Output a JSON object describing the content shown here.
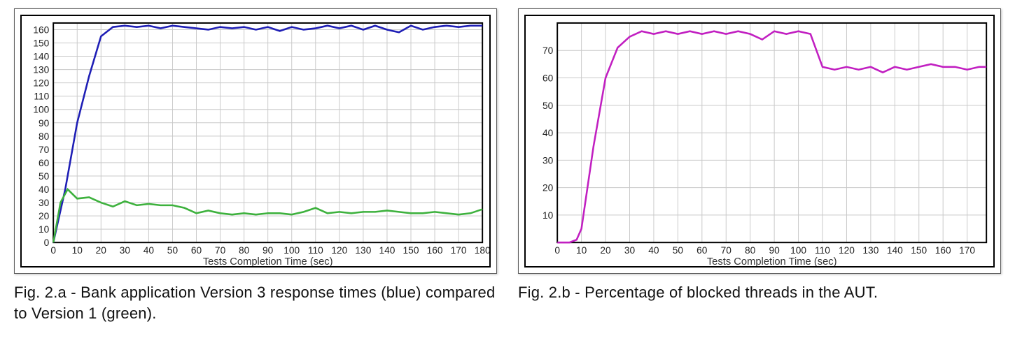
{
  "captions": {
    "a": "Fig. 2.a - Bank application Version 3 response times (blue) compared to Version 1 (green).",
    "b": "Fig. 2.b - Percentage of blocked threads in the AUT."
  },
  "xlabels": {
    "a": "Tests Completion Time (sec)",
    "b": "Tests Completion Time (sec)"
  },
  "chart_data": [
    {
      "id": "a",
      "type": "line",
      "title": "",
      "xlabel": "Tests Completion Time (sec)",
      "ylabel": "",
      "xlim": [
        0,
        180
      ],
      "ylim": [
        0,
        165
      ],
      "xticks": [
        0,
        10,
        20,
        30,
        40,
        50,
        60,
        70,
        80,
        90,
        100,
        110,
        120,
        130,
        140,
        150,
        160,
        170,
        180
      ],
      "yticks": [
        0,
        10,
        20,
        30,
        40,
        50,
        60,
        70,
        80,
        90,
        100,
        110,
        120,
        130,
        140,
        150,
        160
      ],
      "series": [
        {
          "name": "Version 3 (blue)",
          "color": "#1e1eb5",
          "cls": "blue",
          "x": [
            0,
            5,
            10,
            15,
            20,
            25,
            30,
            35,
            40,
            45,
            50,
            55,
            60,
            65,
            70,
            75,
            80,
            85,
            90,
            95,
            100,
            105,
            110,
            115,
            120,
            125,
            130,
            135,
            140,
            145,
            150,
            155,
            160,
            165,
            170,
            175,
            180
          ],
          "y": [
            0,
            40,
            90,
            125,
            155,
            162,
            163,
            162,
            163,
            161,
            163,
            162,
            161,
            160,
            162,
            161,
            162,
            160,
            162,
            159,
            162,
            160,
            161,
            163,
            161,
            163,
            160,
            163,
            160,
            158,
            163,
            160,
            162,
            163,
            162,
            163,
            163
          ]
        },
        {
          "name": "Version 1 (green)",
          "color": "#3db13d",
          "cls": "green",
          "x": [
            0,
            3,
            6,
            10,
            15,
            20,
            25,
            30,
            35,
            40,
            45,
            50,
            55,
            60,
            65,
            70,
            75,
            80,
            85,
            90,
            95,
            100,
            105,
            110,
            115,
            120,
            125,
            130,
            135,
            140,
            145,
            150,
            155,
            160,
            165,
            170,
            175,
            180
          ],
          "y": [
            0,
            30,
            40,
            33,
            34,
            30,
            27,
            31,
            28,
            29,
            28,
            28,
            26,
            22,
            24,
            22,
            21,
            22,
            21,
            22,
            22,
            21,
            23,
            26,
            22,
            23,
            22,
            23,
            23,
            24,
            23,
            22,
            22,
            23,
            22,
            21,
            22,
            25
          ]
        }
      ]
    },
    {
      "id": "b",
      "type": "line",
      "title": "",
      "xlabel": "Tests Completion Time (sec)",
      "ylabel": "",
      "xlim": [
        0,
        178
      ],
      "ylim": [
        0,
        80
      ],
      "xticks": [
        0,
        10,
        20,
        30,
        40,
        50,
        60,
        70,
        80,
        90,
        100,
        110,
        120,
        130,
        140,
        150,
        160,
        170
      ],
      "yticks": [
        10,
        20,
        30,
        40,
        50,
        60,
        70
      ],
      "series": [
        {
          "name": "Blocked threads %",
          "color": "#c11fc1",
          "cls": "magenta",
          "x": [
            0,
            5,
            8,
            10,
            15,
            20,
            25,
            30,
            35,
            40,
            45,
            50,
            55,
            60,
            65,
            70,
            75,
            80,
            85,
            90,
            95,
            100,
            105,
            110,
            115,
            120,
            125,
            130,
            135,
            140,
            145,
            150,
            155,
            160,
            165,
            170,
            175,
            178
          ],
          "y": [
            0,
            0,
            1,
            5,
            35,
            60,
            71,
            75,
            77,
            76,
            77,
            76,
            77,
            76,
            77,
            76,
            77,
            76,
            74,
            77,
            76,
            77,
            76,
            64,
            63,
            64,
            63,
            64,
            62,
            64,
            63,
            64,
            65,
            64,
            64,
            63,
            64,
            64
          ]
        }
      ]
    }
  ]
}
